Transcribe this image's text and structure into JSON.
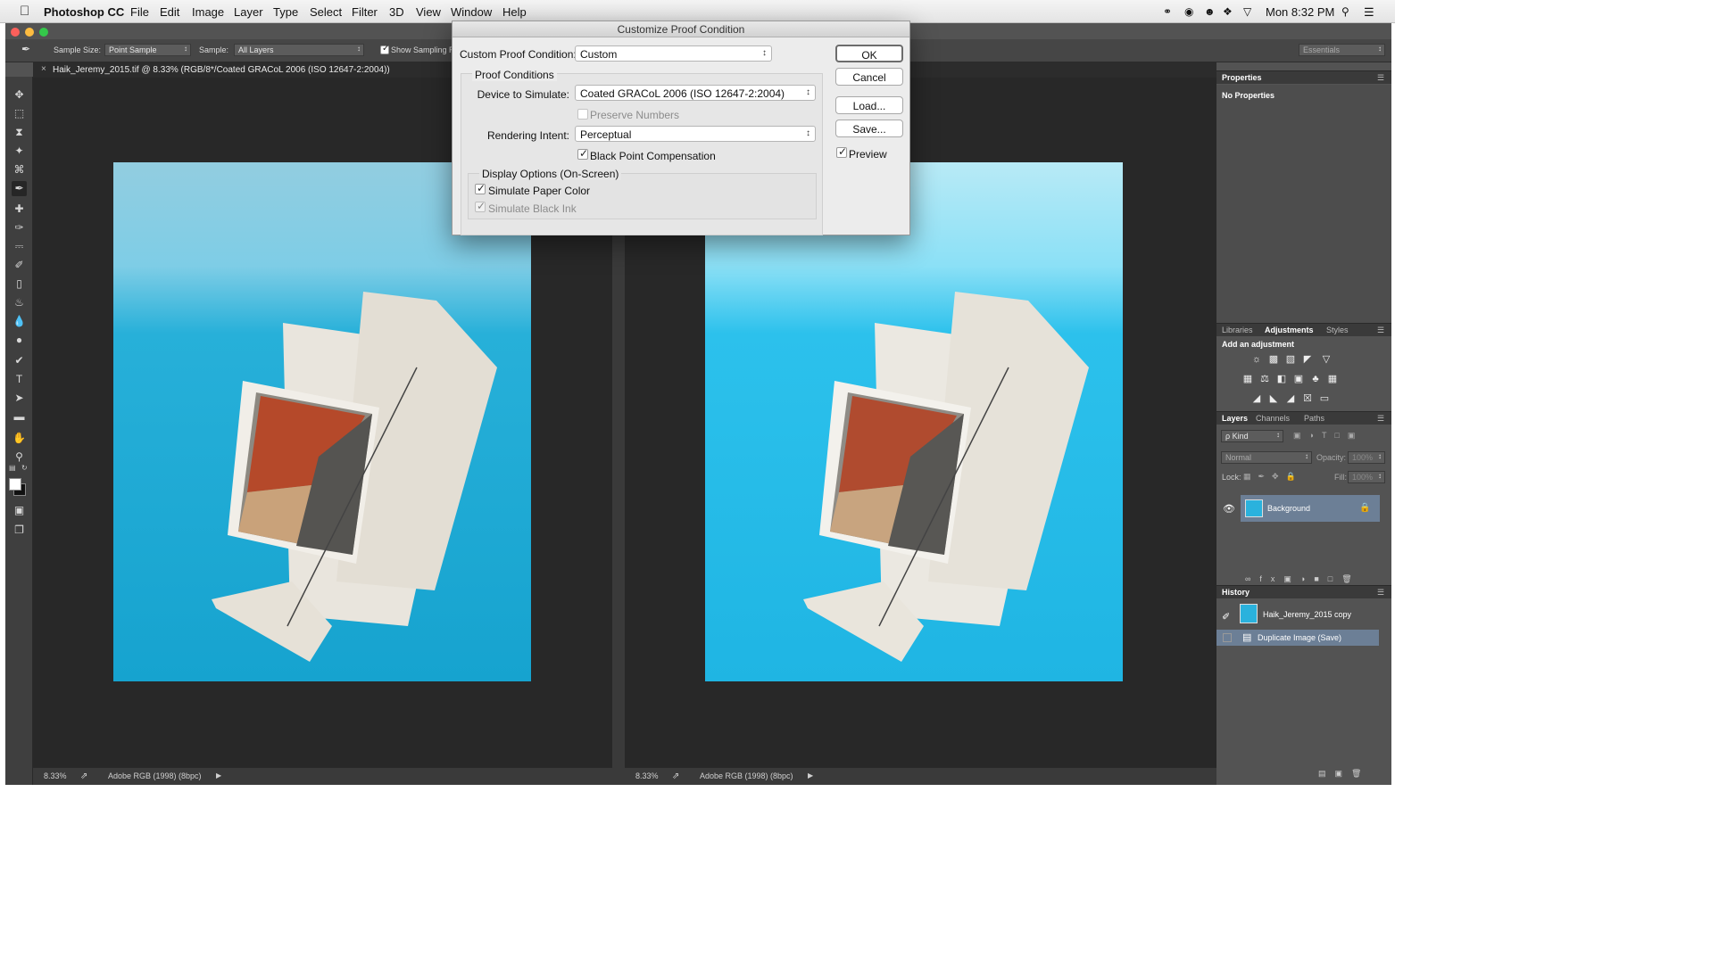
{
  "menubar": {
    "app": "Photoshop CC",
    "items": [
      "File",
      "Edit",
      "Image",
      "Layer",
      "Type",
      "Select",
      "Filter",
      "3D",
      "View",
      "Window",
      "Help"
    ],
    "clock": "Mon 8:32 PM"
  },
  "options": {
    "sample_size_label": "Sample Size:",
    "sample_size_value": "Point Sample",
    "sample_label": "Sample:",
    "sample_value": "All Layers",
    "show_sampling": "Show Sampling R",
    "workspace": "Essentials"
  },
  "document": {
    "tab_title": "Haik_Jeremy_2015.tif @ 8.33% (RGB/8*/Coated GRACoL 2006 (ISO 12647-2:2004))"
  },
  "status": {
    "zoom": "8.33%",
    "profile": "Adobe RGB (1998) (8bpc)"
  },
  "panels": {
    "properties": {
      "tab": "Properties",
      "body": "No Properties"
    },
    "adjustments": {
      "tabs": [
        "Libraries",
        "Adjustments",
        "Styles"
      ],
      "heading": "Add an adjustment"
    },
    "layers": {
      "tabs": [
        "Layers",
        "Channels",
        "Paths"
      ],
      "kind": "ρ Kind",
      "blend": "Normal",
      "opacity_label": "Opacity:",
      "opacity": "100%",
      "lock_label": "Lock:",
      "fill_label": "Fill:",
      "fill": "100%",
      "layer_name": "Background"
    },
    "history": {
      "tab": "History",
      "snapshot": "Haik_Jeremy_2015 copy",
      "state": "Duplicate Image (Save)"
    }
  },
  "dialog": {
    "title": "Customize Proof Condition",
    "custom_label": "Custom Proof Condition:",
    "custom_value": "Custom",
    "proof_group": "Proof Conditions",
    "device_label": "Device to Simulate:",
    "device_value": "Coated GRACoL 2006 (ISO 12647-2:2004)",
    "preserve_numbers": "Preserve Numbers",
    "intent_label": "Rendering Intent:",
    "intent_value": "Perceptual",
    "bpc": "Black Point Compensation",
    "display_group": "Display Options (On-Screen)",
    "paper_color": "Simulate Paper Color",
    "black_ink": "Simulate Black Ink",
    "ok": "OK",
    "cancel": "Cancel",
    "load": "Load...",
    "save": "Save...",
    "preview": "Preview"
  }
}
